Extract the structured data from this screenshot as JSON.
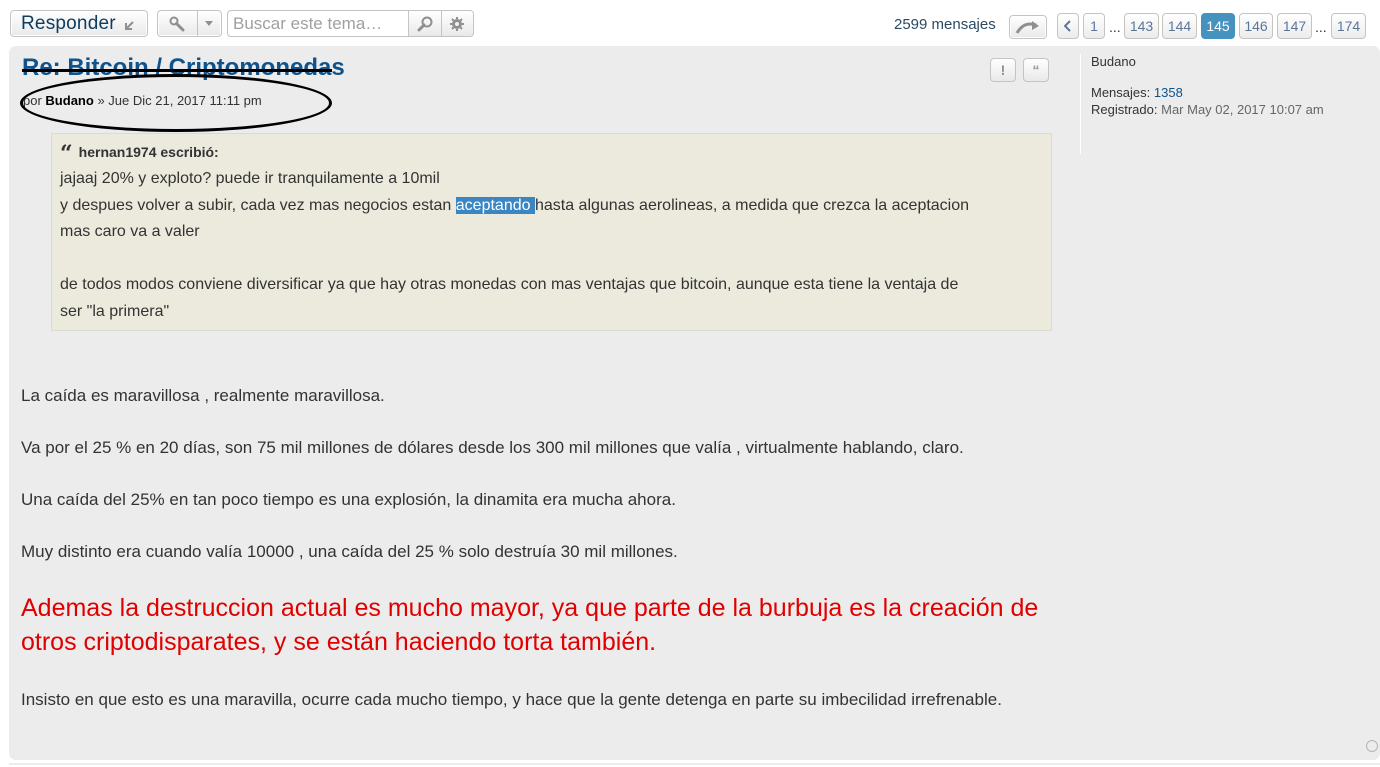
{
  "toolbar": {
    "reply_label": "Responder",
    "search_placeholder": "Buscar este tema…"
  },
  "pagination": {
    "post_count": "2599 mensajes",
    "pages": [
      "1",
      "...",
      "143",
      "144",
      "145",
      "146",
      "147",
      "...",
      "174"
    ],
    "active_page": "145"
  },
  "post": {
    "title": "Re: Bitcoin / Criptomonedas",
    "author_prefix": "por",
    "author": "Budano",
    "separator": "»",
    "date": "Jue Dic 21, 2017 11:11 pm",
    "actions": {
      "report": "!",
      "quote": "“"
    },
    "quote": {
      "cite": "hernan1974 escribió:",
      "line1": "jajaaj 20% y exploto? puede ir tranquilamente a 10mil",
      "line2_before": "y despues volver a subir, cada vez mas negocios estan ",
      "line2_highlight": "aceptando ",
      "line2_after": "hasta algunas aerolineas, a medida que crezca la aceptacion",
      "line3": "mas caro va a valer",
      "line4": "de todos modos conviene diversificar ya que hay otras monedas con mas ventajas que bitcoin, aunque esta tiene la ventaja de",
      "line5": "ser \"la primera\""
    },
    "paragraphs": {
      "p1": "La caída es maravillosa , realmente maravillosa.",
      "p2": "Va por el 25 % en 20 días, son 75 mil millones de dólares desde los 300 mil millones que valía , virtualmente hablando, claro.",
      "p3": "Una caída del 25% en tan poco tiempo es una explosión, la dinamita era mucha ahora.",
      "p4": "Muy distinto era cuando valía 10000 , una caída del 25 % solo destruía 30 mil millones.",
      "p5": "Ademas la destruccion actual es mucho mayor, ya que parte de la burbuja es la creación de otros criptodisparates, y se están haciendo torta también.",
      "p6": "Insisto en que esto es una maravilla, ocurre cada mucho tiempo, y hace que la gente detenga en parte su imbecilidad irrefrenable."
    }
  },
  "profile": {
    "username": "Budano",
    "posts_label": "Mensajes:",
    "posts_value": "1358",
    "registered_label": "Registrado:",
    "registered_value": "Mar May 02, 2017 10:07 am"
  },
  "colors": {
    "link": "#105289",
    "active_page": "#4692bf",
    "quote_bg": "#ebeadd",
    "post_bg": "#ececec",
    "emphasis_red": "#e00000",
    "selection": "#3a86c4"
  },
  "icons": [
    "reply-arrow-icon",
    "wrench-icon",
    "caret-down-icon",
    "search-icon",
    "gear-icon",
    "jump-arrow-icon",
    "chevron-left-icon",
    "quote-mark-icon",
    "scroll-top-icon"
  ]
}
